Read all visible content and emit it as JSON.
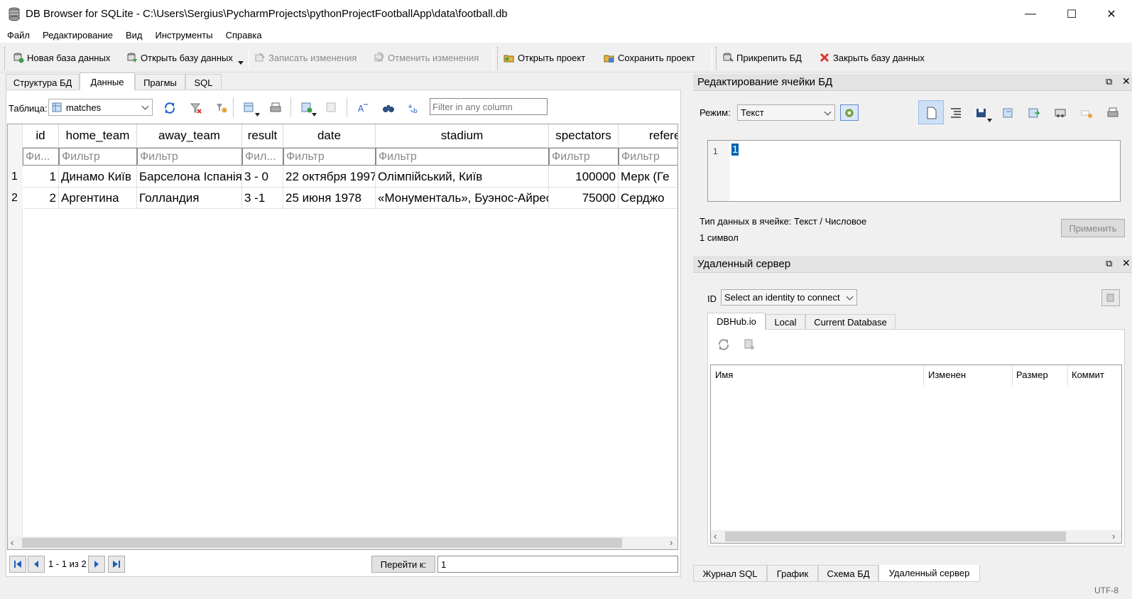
{
  "window": {
    "title": "DB Browser for SQLite - C:\\Users\\Sergius\\PycharmProjects\\pythonProjectFootballApp\\data\\football.db",
    "minimize": "—",
    "maximize": "☐",
    "close": "✕"
  },
  "menu": [
    "Файл",
    "Редактирование",
    "Вид",
    "Инструменты",
    "Справка"
  ],
  "toolbar": {
    "new_db": "Новая база данных",
    "open_db": "Открыть базу данных",
    "write_changes": "Записать изменения",
    "revert_changes": "Отменить изменения",
    "open_project": "Открыть проект",
    "save_project": "Сохранить проект",
    "attach_db": "Прикрепить БД",
    "close_db": "Закрыть базу данных"
  },
  "main_tabs": [
    "Структура БД",
    "Данные",
    "Прагмы",
    "SQL"
  ],
  "browse": {
    "table_label": "Таблица:",
    "table_value": "matches",
    "filter_placeholder": "Filter in any column"
  },
  "grid": {
    "columns": [
      "id",
      "home_team",
      "away_team",
      "result",
      "date",
      "stadium",
      "spectators",
      "referee"
    ],
    "filters": [
      "Фи...",
      "Фильтр",
      "Фильтр",
      "Фил...",
      "Фильтр",
      "Фильтр",
      "Фильтр",
      "Фильтр"
    ],
    "rows": [
      {
        "rownum": "1",
        "id": "1",
        "home_team": "Динамо Київ",
        "away_team": "Барселона Іспанія",
        "result": "3 - 0",
        "date": "22 октября 1997",
        "stadium": "Олімпійський, Київ",
        "spectators": "100000",
        "referee": "Мерк (Ге"
      },
      {
        "rownum": "2",
        "id": "2",
        "home_team": "Аргентина",
        "away_team": "Голландия",
        "result": "3 -1",
        "date": "25 июня 1978",
        "stadium": "«Монументаль», Буэнос-Айрес",
        "spectators": "75000",
        "referee": "Серджо"
      }
    ]
  },
  "pager": {
    "range": "1 - 1 из 2",
    "goto_label": "Перейти к:",
    "goto_value": "1"
  },
  "edit_cell": {
    "title": "Редактирование ячейки БД",
    "mode_label": "Режим:",
    "mode_value": "Текст",
    "line_number": "1",
    "content": "1",
    "data_type": "Тип данных в ячейке: Текст / Числовое",
    "char_count": "1 символ",
    "apply": "Применить"
  },
  "remote": {
    "title": "Удаленный сервер",
    "id_label": "ID",
    "identity_value": "Select an identity to connect",
    "tabs": [
      "DBHub.io",
      "Local",
      "Current Database"
    ],
    "columns": [
      "Имя",
      "Изменен",
      "Размер",
      "Коммит"
    ]
  },
  "bottom_tabs": [
    "Журнал SQL",
    "График",
    "Схема БД",
    "Удаленный сервер"
  ],
  "status": {
    "encoding": "UTF-8"
  },
  "colors": {
    "selection": "#0063b1",
    "accent_blue": "#1e5fbf",
    "close_red": "#d9352b"
  }
}
